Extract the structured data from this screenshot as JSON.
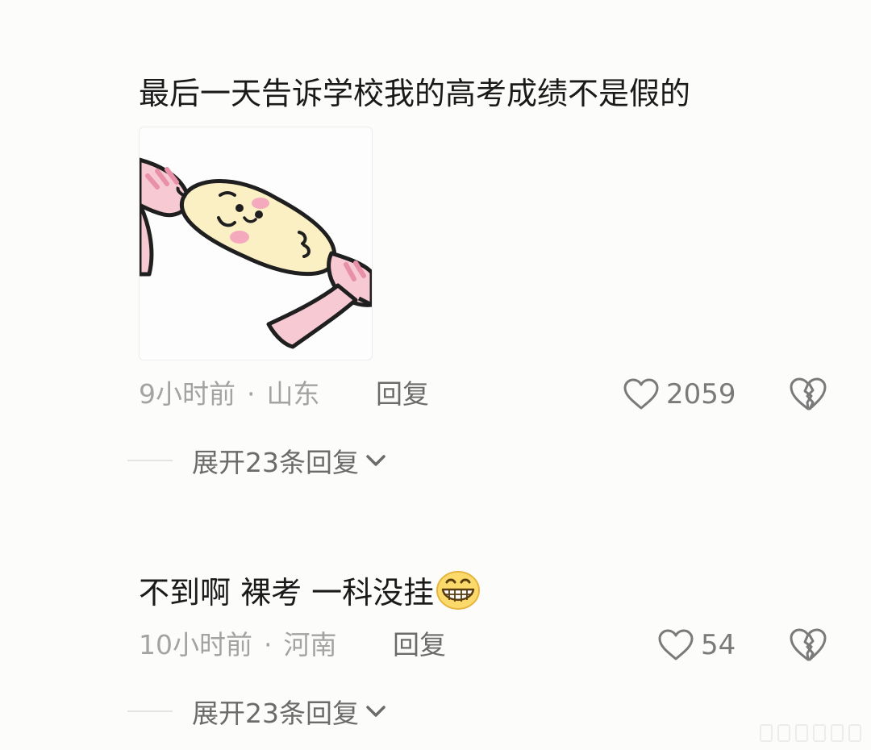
{
  "comments": [
    {
      "text": "最后一天告诉学校我的高考成绩不是假的",
      "has_sticker": true,
      "sticker_icon": "bread-stretch-sticker-icon",
      "time": "9小时前",
      "separator": "·",
      "location": "山东",
      "reply_label": "回复",
      "likes": "2059",
      "expand_label": "展开23条回复"
    },
    {
      "text": "不到啊 裸考 一科没挂",
      "emoji_icon": "grinning-face-icon",
      "time": "10小时前",
      "separator": "·",
      "location": "河南",
      "reply_label": "回复",
      "likes": "54",
      "expand_label": "展开23条回复"
    }
  ],
  "icons": {
    "like": "heart-outline-icon",
    "dislike": "broken-heart-icon",
    "expand": "chevron-down-icon"
  },
  "colors": {
    "background": "#fcfcfb",
    "text_primary": "#1a1a1a",
    "text_meta": "#a3a3a3",
    "text_action": "#6b6b6b"
  }
}
